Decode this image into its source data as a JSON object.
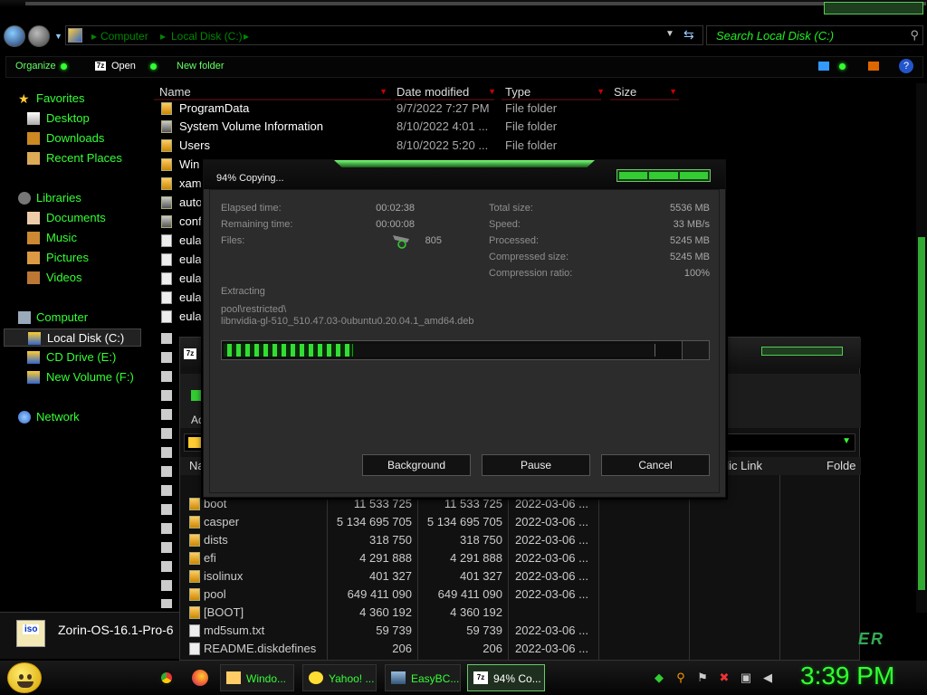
{
  "explorer": {
    "breadcrumb": [
      "Computer",
      "Local Disk (C:)"
    ],
    "search_placeholder": "Search Local Disk (C:)",
    "toolbar": {
      "organize": "Organize",
      "open": "Open",
      "new_folder": "New folder"
    },
    "sidebar": {
      "favorites": {
        "label": "Favorites",
        "items": [
          "Desktop",
          "Downloads",
          "Recent Places"
        ]
      },
      "libraries": {
        "label": "Libraries",
        "items": [
          "Documents",
          "Music",
          "Pictures",
          "Videos"
        ]
      },
      "computer": {
        "label": "Computer",
        "items": [
          "Local Disk (C:)",
          "CD Drive (E:)",
          "New Volume (F:)"
        ]
      },
      "network": {
        "label": "Network"
      }
    },
    "columns": [
      "Name",
      "Date modified",
      "Type",
      "Size"
    ],
    "files": [
      {
        "name": "ProgramData",
        "date": "9/7/2022 7:27 PM",
        "type": "File folder"
      },
      {
        "name": "System Volume Information",
        "date": "8/10/2022 4:01 ...",
        "type": "File folder"
      },
      {
        "name": "Users",
        "date": "8/10/2022 5:20 ...",
        "type": "File folder"
      },
      {
        "name": "Win",
        "date": "",
        "type": ""
      },
      {
        "name": "xam",
        "date": "",
        "type": ""
      },
      {
        "name": "auto",
        "date": "",
        "type": ""
      },
      {
        "name": "conf",
        "date": "",
        "type": ""
      },
      {
        "name": "eula",
        "date": "",
        "type": ""
      },
      {
        "name": "eula",
        "date": "",
        "type": ""
      },
      {
        "name": "eula",
        "date": "",
        "type": ""
      },
      {
        "name": "eula",
        "date": "",
        "type": ""
      },
      {
        "name": "eula",
        "date": "",
        "type": ""
      }
    ]
  },
  "archive_window": {
    "add_label": "Ad",
    "columns": [
      "Na",
      "blic Link",
      "Folde"
    ],
    "rows": [
      {
        "name": "boot",
        "size": "11 533 725",
        "packed": "11 533 725",
        "modified": "2022-03-06 ..."
      },
      {
        "name": "casper",
        "size": "5 134 695 705",
        "packed": "5 134 695 705",
        "modified": "2022-03-06 ..."
      },
      {
        "name": "dists",
        "size": "318 750",
        "packed": "318 750",
        "modified": "2022-03-06 ..."
      },
      {
        "name": "efi",
        "size": "4 291 888",
        "packed": "4 291 888",
        "modified": "2022-03-06 ..."
      },
      {
        "name": "isolinux",
        "size": "401 327",
        "packed": "401 327",
        "modified": "2022-03-06 ..."
      },
      {
        "name": "pool",
        "size": "649 411 090",
        "packed": "649 411 090",
        "modified": "2022-03-06 ..."
      },
      {
        "name": "[BOOT]",
        "size": "4 360 192",
        "packed": "4 360 192",
        "modified": ""
      },
      {
        "name": "md5sum.txt",
        "size": "59 739",
        "packed": "59 739",
        "modified": "2022-03-06 ..."
      },
      {
        "name": "README.diskdefines",
        "size": "206",
        "packed": "206",
        "modified": "2022-03-06 ..."
      }
    ],
    "brand_text": "ER"
  },
  "iso_item": {
    "badge": "iso",
    "name": "Zorin-OS-16.1-Pro-6"
  },
  "copy_dialog": {
    "title": "94% Copying...",
    "progress_fraction": 0.94,
    "stats_left": [
      {
        "label": "Elapsed time:",
        "value": "00:02:38"
      },
      {
        "label": "Remaining time:",
        "value": "00:00:08"
      },
      {
        "label": "Files:",
        "value": "805"
      }
    ],
    "stats_right": [
      {
        "label": "Total size:",
        "value": "5536 MB"
      },
      {
        "label": "Speed:",
        "value": "33 MB/s"
      },
      {
        "label": "Processed:",
        "value": "5245 MB"
      },
      {
        "label": "Compressed size:",
        "value": "5245 MB"
      },
      {
        "label": "Compression ratio:",
        "value": "100%"
      }
    ],
    "operation": "Extracting",
    "path_line1": "pool\\restricted\\",
    "path_line2": "libnvidia-gl-510_510.47.03-0ubuntu0.20.04.1_amd64.deb",
    "buttons": {
      "background": "Background",
      "pause": "Pause",
      "cancel": "Cancel"
    }
  },
  "taskbar": {
    "tasks": [
      {
        "label": "Windo...",
        "icon": "folder-icon"
      },
      {
        "label": "Yahoo! ...",
        "icon": "yahoo-messenger-icon"
      },
      {
        "label": "EasyBC...",
        "icon": "easybcd-icon"
      },
      {
        "label": "94% Co...",
        "icon": "7zip-icon"
      }
    ],
    "clock": "3:39 PM"
  },
  "colors": {
    "accent": "#33ff33",
    "background": "#000000",
    "dialog": "#2c2c2c"
  }
}
